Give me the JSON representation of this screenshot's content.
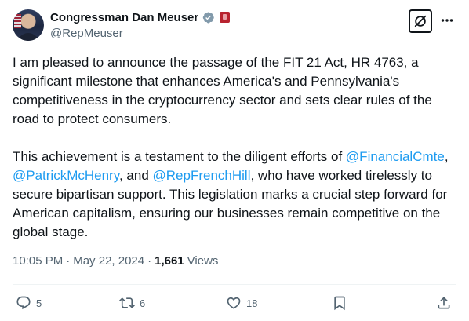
{
  "author": {
    "display_name": "Congressman Dan Meuser",
    "handle": "@RepMeuser"
  },
  "tweet": {
    "paragraph1": "I am pleased to announce the passage of the FIT 21 Act, HR 4763, a significant milestone that enhances America's and Pennsylvania's competitiveness in the cryptocurrency sector and sets clear rules of the road to protect consumers.",
    "p2_part1": "This achievement is a testament to the diligent efforts of ",
    "mention1": "@FinancialCmte",
    "p2_part2": ", ",
    "mention2": "@PatrickMcHenry",
    "p2_part3": ", and ",
    "mention3": "@RepFrenchHill",
    "p2_part4": ", who have worked tirelessly to secure bipartisan support. This legislation marks a crucial step forward for American capitalism, ensuring our businesses remain competitive on the global stage."
  },
  "meta": {
    "time": "10:05 PM",
    "dot1": "·",
    "date": "May 22, 2024",
    "dot2": "·",
    "views_count": "1,661",
    "views_label": "Views"
  },
  "actions": {
    "replies": "5",
    "reposts": "6",
    "likes": "18"
  },
  "icons": [
    "verified-icon",
    "government-badge-icon",
    "grok-icon",
    "more-icon",
    "reply-icon",
    "repost-icon",
    "like-icon",
    "bookmark-icon",
    "share-icon"
  ],
  "colors": {
    "link": "#1d9bf0",
    "verified": "#829aab",
    "gov_badge": "#b8232f",
    "secondary_text": "#536471"
  }
}
